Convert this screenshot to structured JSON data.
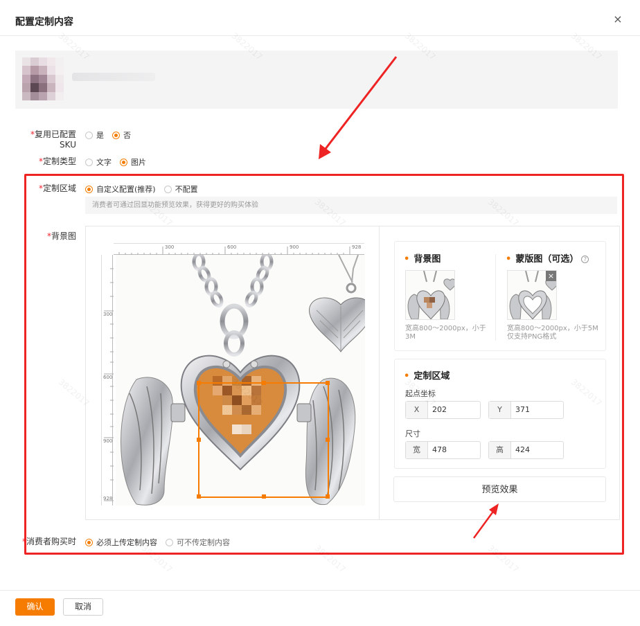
{
  "modal": {
    "title": "配置定制内容",
    "close_label": "×"
  },
  "form": {
    "reuse_sku": {
      "label": "复用已配置SKU",
      "options": [
        "是",
        "否"
      ],
      "selected": "否"
    },
    "custom_type": {
      "label": "定制类型",
      "options": [
        "文字",
        "图片"
      ],
      "selected": "图片"
    },
    "custom_area": {
      "label": "定制区域",
      "options": [
        "自定义配置(推荐)",
        "不配置"
      ],
      "selected": "自定义配置(推荐)",
      "hint": "消费者可通过回显功能预览效果，获得更好的购买体验"
    },
    "background": {
      "label": "背景图"
    },
    "buyer": {
      "label": "消费者购买时",
      "options": [
        "必须上传定制内容",
        "可不传定制内容"
      ],
      "selected": "必须上传定制内容"
    }
  },
  "ruler": {
    "top_ticks": [
      "300",
      "600",
      "900",
      "928"
    ],
    "left_ticks": [
      "300",
      "600",
      "900",
      "928"
    ]
  },
  "panel_images": {
    "bg_title": "背景图",
    "bg_note": "宽高800～2000px，小于3M",
    "mask_title": "蒙版图（可选）",
    "mask_note": "宽高800～2000px，小于5M 仅支持PNG格式"
  },
  "panel_area": {
    "title": "定制区域",
    "origin_label": "起点坐标",
    "x_key": "X",
    "x_value": "202",
    "y_key": "Y",
    "y_value": "371",
    "size_label": "尺寸",
    "w_key": "宽",
    "w_value": "478",
    "h_key": "高",
    "h_value": "424"
  },
  "preview_button": "预览效果",
  "footer": {
    "confirm": "确认",
    "cancel": "取消"
  },
  "watermark_text": "3822017",
  "colors": {
    "accent": "#f57c00",
    "annotation": "#ee2323"
  }
}
